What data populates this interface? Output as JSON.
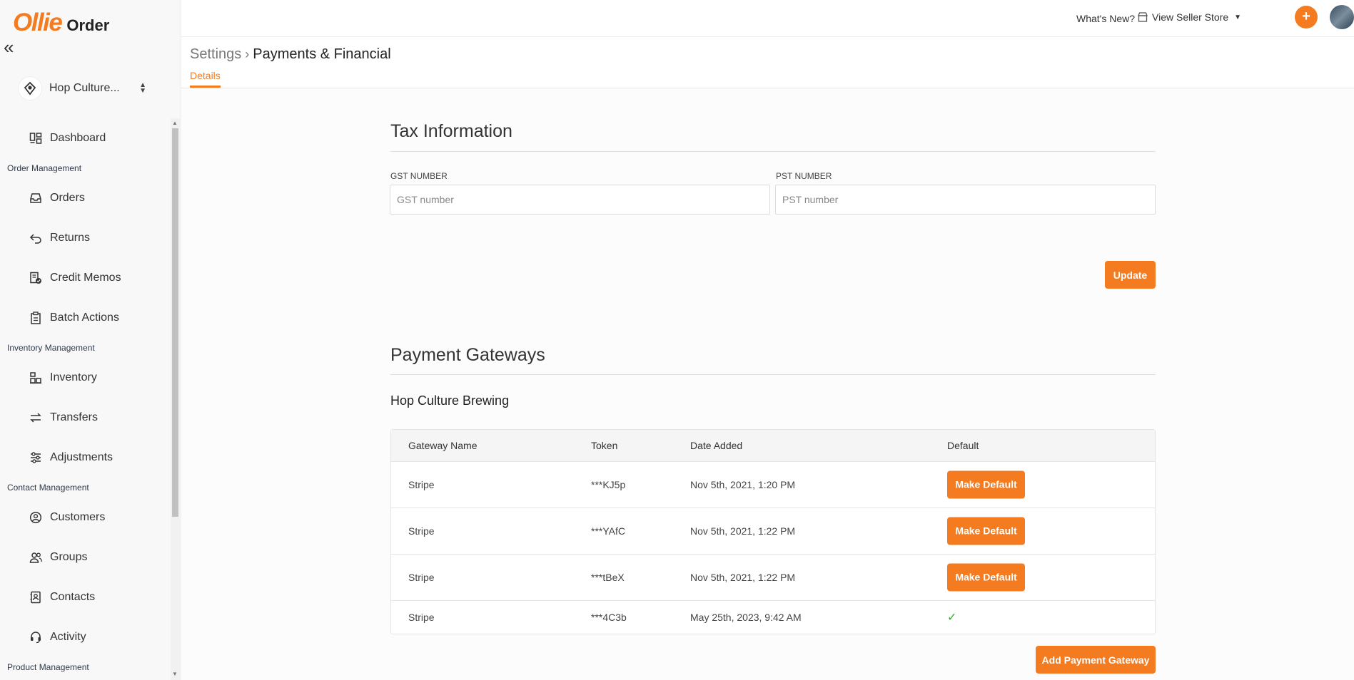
{
  "brand": {
    "logo_main": "Ollie",
    "logo_sub": "Order"
  },
  "store": {
    "name": "Hop Culture..."
  },
  "header": {
    "whats_new": "What's New?",
    "view_store": "View Seller Store"
  },
  "sidebar": {
    "items": [
      {
        "type": "item",
        "label": "Dashboard",
        "icon": "dashboard-icon"
      },
      {
        "type": "section",
        "label": "Order Management"
      },
      {
        "type": "item",
        "label": "Orders",
        "icon": "inbox-icon"
      },
      {
        "type": "item",
        "label": "Returns",
        "icon": "return-icon"
      },
      {
        "type": "item",
        "label": "Credit Memos",
        "icon": "credit-memo-icon"
      },
      {
        "type": "item",
        "label": "Batch Actions",
        "icon": "clipboard-icon"
      },
      {
        "type": "section",
        "label": "Inventory Management"
      },
      {
        "type": "item",
        "label": "Inventory",
        "icon": "inventory-icon"
      },
      {
        "type": "item",
        "label": "Transfers",
        "icon": "transfer-icon"
      },
      {
        "type": "item",
        "label": "Adjustments",
        "icon": "sliders-icon"
      },
      {
        "type": "section",
        "label": "Contact Management"
      },
      {
        "type": "item",
        "label": "Customers",
        "icon": "user-circle-icon"
      },
      {
        "type": "item",
        "label": "Groups",
        "icon": "users-icon"
      },
      {
        "type": "item",
        "label": "Contacts",
        "icon": "contact-card-icon"
      },
      {
        "type": "item",
        "label": "Activity",
        "icon": "headset-icon"
      },
      {
        "type": "section",
        "label": "Product Management"
      }
    ]
  },
  "breadcrumb": {
    "parent": "Settings",
    "current": "Payments & Financial"
  },
  "tabs": {
    "details": "Details"
  },
  "tax": {
    "title": "Tax Information",
    "gst_label": "GST NUMBER",
    "gst_placeholder": "GST number",
    "gst_value": "",
    "pst_label": "PST NUMBER",
    "pst_placeholder": "PST number",
    "pst_value": "",
    "update_label": "Update"
  },
  "gateways": {
    "title": "Payment Gateways",
    "company": "Hop Culture Brewing",
    "columns": [
      "Gateway Name",
      "Token",
      "Date Added",
      "Default"
    ],
    "rows": [
      {
        "name": "Stripe",
        "token": "***KJ5p",
        "date": "Nov 5th, 2021, 1:20 PM",
        "is_default": false,
        "action": "Make Default"
      },
      {
        "name": "Stripe",
        "token": "***YAfC",
        "date": "Nov 5th, 2021, 1:22 PM",
        "is_default": false,
        "action": "Make Default"
      },
      {
        "name": "Stripe",
        "token": "***tBeX",
        "date": "Nov 5th, 2021, 1:22 PM",
        "is_default": false,
        "action": "Make Default"
      },
      {
        "name": "Stripe",
        "token": "***4C3b",
        "date": "May 25th, 2023, 9:42 AM",
        "is_default": true,
        "action": ""
      }
    ],
    "add_label": "Add Payment Gateway"
  },
  "colors": {
    "accent": "#f47b20",
    "check": "#3aa83a"
  }
}
